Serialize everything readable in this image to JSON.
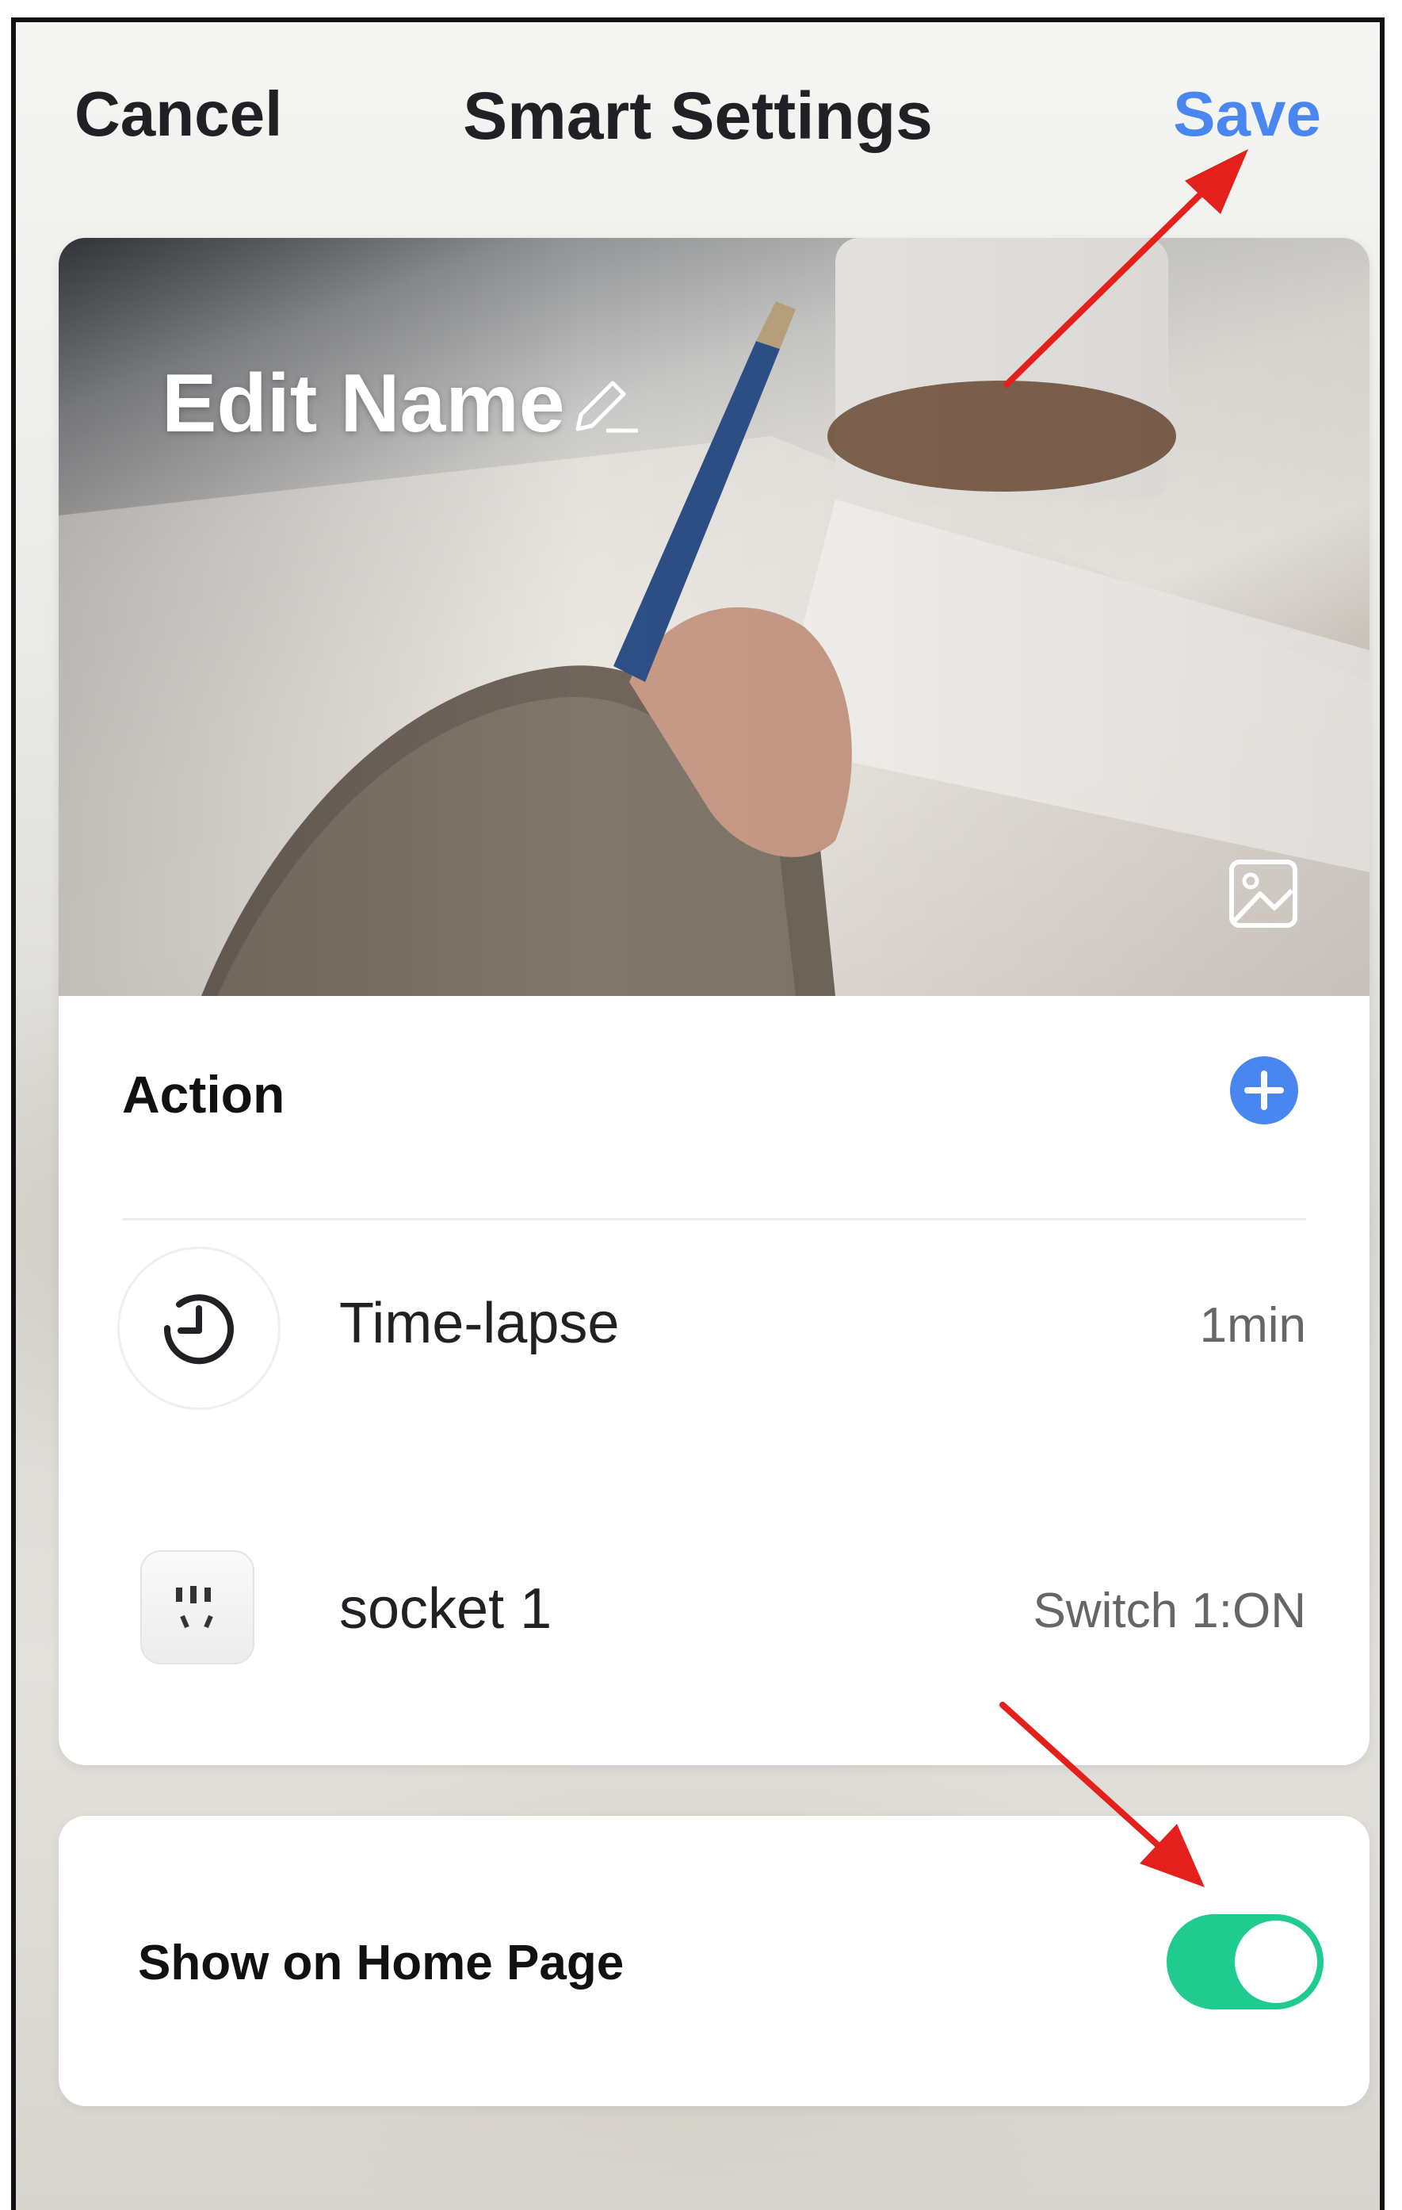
{
  "header": {
    "cancel_label": "Cancel",
    "title": "Smart Settings",
    "save_label": "Save"
  },
  "hero": {
    "name_label": "Edit Name",
    "edit_icon": "pencil-icon",
    "image_icon": "image-icon"
  },
  "action": {
    "label": "Action",
    "add_icon": "plus-icon",
    "items": [
      {
        "icon": "clock-icon",
        "name": "Time-lapse",
        "value": "1min"
      },
      {
        "icon": "socket-icon",
        "name": "socket 1",
        "value": "Switch 1:ON"
      }
    ]
  },
  "home_page": {
    "label": "Show on Home Page",
    "toggle_on": true
  },
  "colors": {
    "accent_blue": "#4a86f0",
    "toggle_green": "#1fcb8e",
    "annotation_red": "#e3201b"
  }
}
